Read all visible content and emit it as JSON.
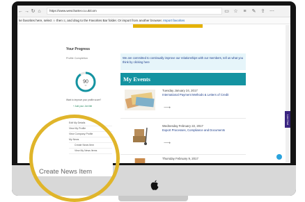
{
  "browser": {
    "url": "https://www.wescharter.co.uk/com",
    "favorites_bar": {
      "text": "ke favorites here, select ☆ then ≡, and drag to the Favorites Bar folder. Or import from another browser.",
      "import_link": "Import favorites"
    }
  },
  "sidebar": {
    "title": "Your Progress",
    "subtitle": "Profile Completion",
    "progress_value": "90",
    "progress_unit": "%",
    "progress_fraction": 0.9,
    "improve_text": "Want to improve your profile score?",
    "add_job_link": "+ Add your Job title",
    "links": [
      {
        "label": "Edit My Details",
        "sub": false
      },
      {
        "label": "View My Profile",
        "sub": false
      },
      {
        "label": "View Company Profile",
        "sub": false
      },
      {
        "label": "My News",
        "sub": false
      },
      {
        "label": "Create News Item",
        "sub": true
      },
      {
        "label": "View My News Items",
        "sub": true
      }
    ]
  },
  "notice": {
    "text": "We are committed to continually improve our relationships with our members, tell us what you think by clicking here"
  },
  "events": {
    "heading": "My Events",
    "items": [
      {
        "date": "Tuesday January 24, 2017",
        "title": "International Payment Methods & Letters of Credit"
      },
      {
        "date": "Wednesday February 22, 2017",
        "title": "Export Processes, Compliance and Documents"
      },
      {
        "date": "Thursday February 9, 2017",
        "title": ""
      }
    ]
  },
  "livechat": {
    "label": "Live Chat"
  },
  "zoom_callout": {
    "label": "Create News Item"
  },
  "colors": {
    "teal": "#1493a1",
    "gold": "#e0b52a",
    "purple": "#3a2580"
  }
}
